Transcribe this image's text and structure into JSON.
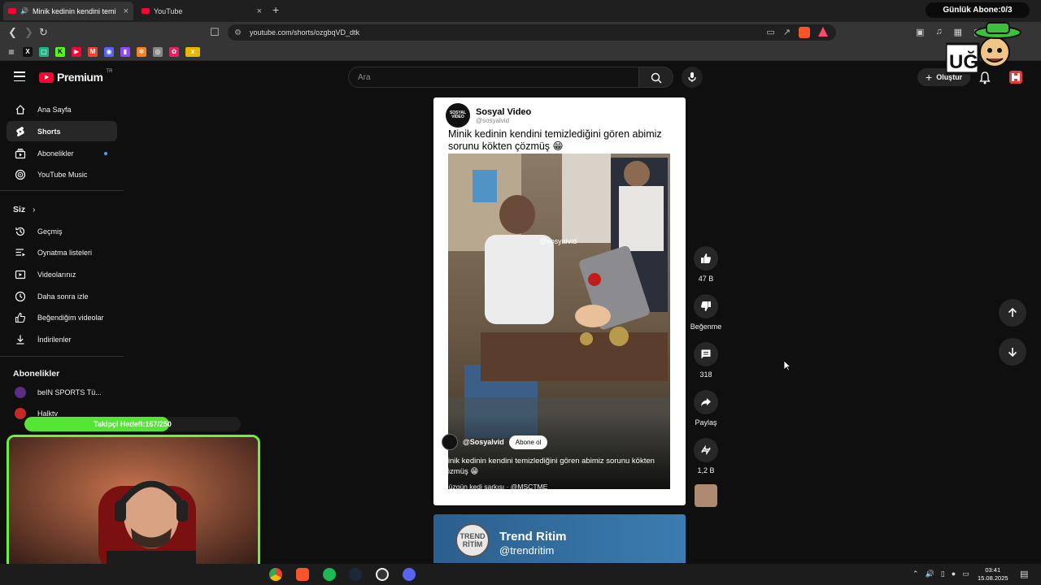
{
  "browser": {
    "tabs": [
      {
        "title": "Minik kedinin kendini temizle"
      },
      {
        "title": "YouTube"
      }
    ],
    "url": "youtube.com/shorts/ozgbqVD_dtk",
    "new_tab": "+",
    "close": "×"
  },
  "overlay": {
    "sub_counter": "Günlük Abone:0/3",
    "follow_goal": "Takipçi Hedefi:167/250",
    "follow_progress": 0.668
  },
  "header": {
    "logo_text": "Premium",
    "logo_region": "TR",
    "search_placeholder": "Ara",
    "create_label": "Oluştur"
  },
  "sidebar": {
    "main": [
      {
        "label": "Ana Sayfa",
        "icon": "home-icon"
      },
      {
        "label": "Shorts",
        "icon": "shorts-icon"
      },
      {
        "label": "Abonelikler",
        "icon": "subscriptions-icon"
      },
      {
        "label": "YouTube Music",
        "icon": "music-icon"
      }
    ],
    "you_heading": "Siz",
    "you": [
      {
        "label": "Geçmiş",
        "icon": "history-icon"
      },
      {
        "label": "Oynatma listeleri",
        "icon": "playlist-icon"
      },
      {
        "label": "Videolarınız",
        "icon": "your-videos-icon"
      },
      {
        "label": "Daha sonra izle",
        "icon": "watch-later-icon"
      },
      {
        "label": "Beğendiğim videolar",
        "icon": "liked-icon"
      },
      {
        "label": "İndirilenler",
        "icon": "download-icon"
      }
    ],
    "subs_heading": "Abonelikler",
    "subs": [
      {
        "label": "beIN SPORTS Tü..."
      },
      {
        "label": "Halktv"
      }
    ]
  },
  "short": {
    "channel_name": "Sosyal Video",
    "channel_handle": "@sosyalvid",
    "channel_logo_text": "SOSYAL VİDEO",
    "caption": "Minik kedinin kendini temizlediğini gören abimiz sorunu kökten çözmüş 😁",
    "watermark": "@sosyalvid",
    "overlay_channel": "@Sosyalvid",
    "subscribe_label": "Abone ol",
    "overlay_title": "Minik kedinin kendini temizlediğini gören abimiz sorunu kökten çözmüş 😁",
    "sound": "♫ üzgün kedi şarkısı · @MSCTME"
  },
  "next_short": {
    "logo_text": "TREND RİTİM",
    "name": "Trend Ritim",
    "handle": "@trendritim"
  },
  "actions": {
    "likes": "47 B",
    "dislike_label": "Beğenme",
    "comments": "318",
    "share_label": "Paylaş",
    "remix": "1,2 B"
  },
  "taskbar": {
    "time": "03:41",
    "date": "15.08.2025"
  }
}
